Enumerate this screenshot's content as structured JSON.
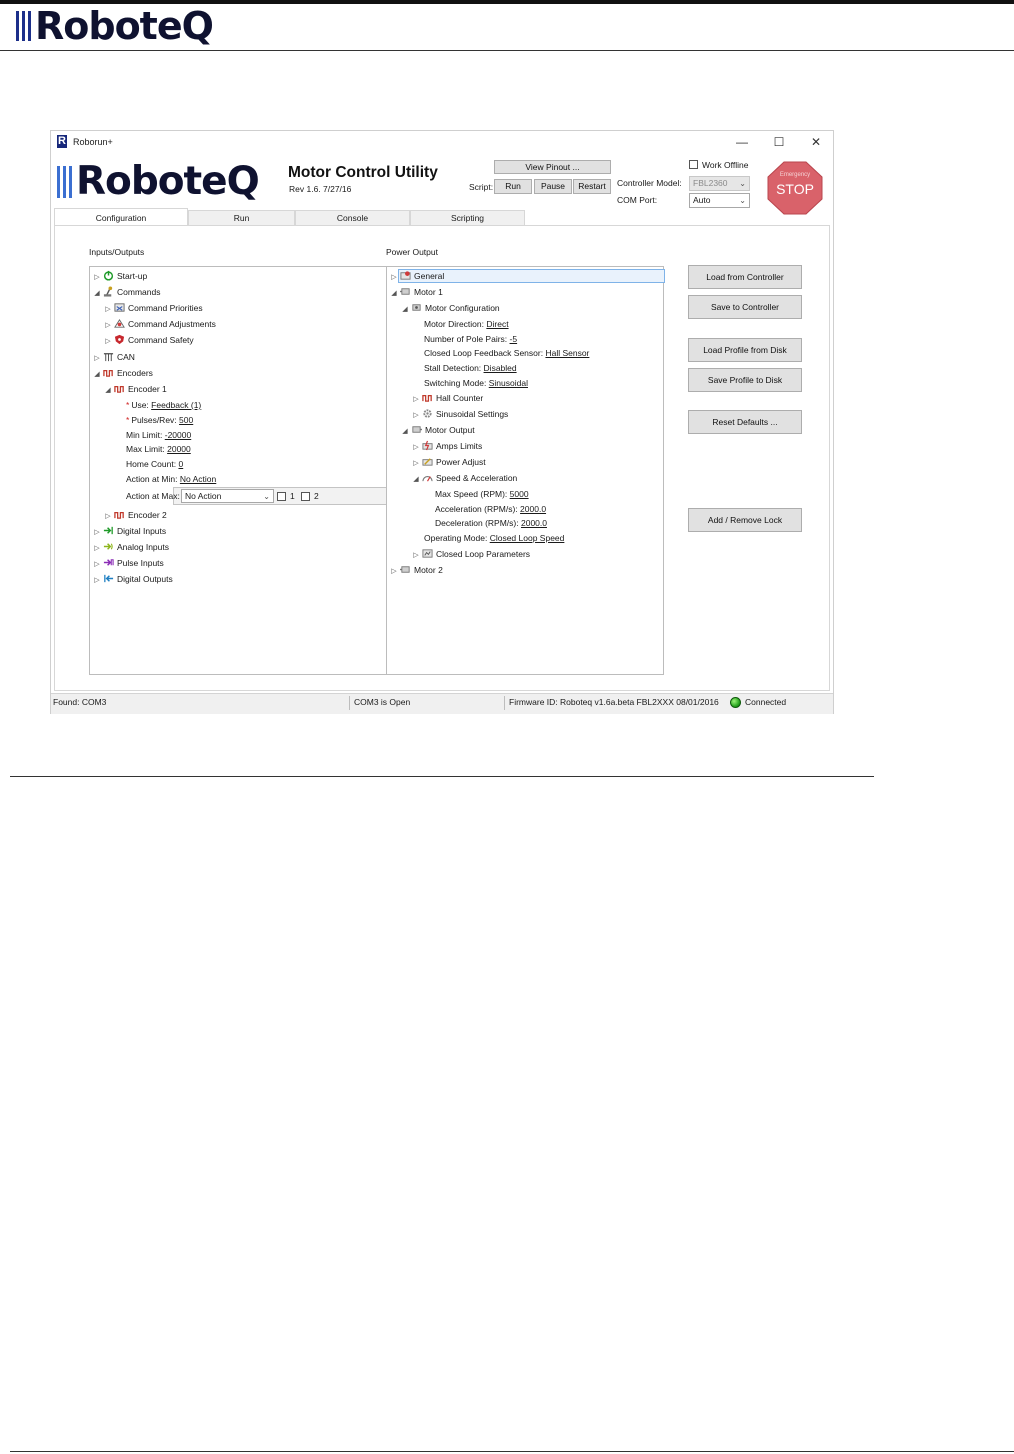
{
  "page": {
    "brand": "RoboteQ"
  },
  "window": {
    "title": "Roborun+",
    "controls": {
      "minimize": "—",
      "maximize": "☐",
      "close": "✕"
    }
  },
  "app_header": {
    "logo_text": "RoboteQ",
    "title": "Motor Control Utility",
    "revision": "Rev 1.6. 7/27/16",
    "view_pinout": "View Pinout ...",
    "script_label": "Script:",
    "run": "Run",
    "pause": "Pause",
    "restart": "Restart",
    "work_offline": "Work Offline",
    "controller_model_label": "Controller Model:",
    "controller_model_value": "FBL2360",
    "com_port_label": "COM Port:",
    "com_port_value": "Auto",
    "estop_small": "Emergency",
    "estop_big": "STOP"
  },
  "tabs": [
    "Configuration",
    "Run",
    "Console",
    "Scripting"
  ],
  "inputs_outputs": {
    "label": "Inputs/Outputs",
    "startup": "Start-up",
    "commands": "Commands",
    "command_priorities": "Command Priorities",
    "command_adjustments": "Command Adjustments",
    "command_safety": "Command Safety",
    "can": "CAN",
    "encoders": "Encoders",
    "encoder1": "Encoder 1",
    "use_label": "Use:",
    "use_value": "Feedback (1)",
    "pulses_label": "Pulses/Rev:",
    "pulses_value": "500",
    "min_limit_label": "Min Limit:",
    "min_limit_value": "-20000",
    "max_limit_label": "Max Limit:",
    "max_limit_value": "20000",
    "home_count_label": "Home Count:",
    "home_count_value": "0",
    "action_min_label": "Action at Min:",
    "action_min_value": "No Action",
    "action_max_label": "Action at Max:",
    "action_max_value": "No Action",
    "check1": "1",
    "check2": "2",
    "encoder2": "Encoder 2",
    "digital_inputs": "Digital Inputs",
    "analog_inputs": "Analog Inputs",
    "pulse_inputs": "Pulse Inputs",
    "digital_outputs": "Digital Outputs"
  },
  "power_output": {
    "label": "Power Output",
    "general": "General",
    "motor1": "Motor 1",
    "motor_config": "Motor Configuration",
    "motor_direction_label": "Motor Direction:",
    "motor_direction_value": "Direct",
    "pole_pairs_label": "Number of Pole Pairs:",
    "pole_pairs_value": "-5",
    "feedback_sensor_label": "Closed Loop Feedback Sensor:",
    "feedback_sensor_value": "Hall Sensor",
    "stall_label": "Stall Detection:",
    "stall_value": "Disabled",
    "switching_label": "Switching Mode:",
    "switching_value": "Sinusoidal",
    "hall_counter": "Hall Counter",
    "sinusoidal_settings": "Sinusoidal Settings",
    "motor_output": "Motor Output",
    "amps_limits": "Amps Limits",
    "power_adjust": "Power Adjust",
    "speed_accel": "Speed & Acceleration",
    "max_speed_label": "Max Speed (RPM):",
    "max_speed_value": "5000",
    "accel_label": "Acceleration (RPM/s):",
    "accel_value": "2000.0",
    "decel_label": "Deceleration (RPM/s):",
    "decel_value": "2000.0",
    "op_mode_label": "Operating Mode:",
    "op_mode_value": "Closed Loop Speed",
    "closed_loop_params": "Closed Loop Parameters",
    "motor2": "Motor 2"
  },
  "actions": {
    "load_controller": "Load from Controller",
    "save_controller": "Save to Controller",
    "load_profile": "Load Profile from Disk",
    "save_profile": "Save Profile to Disk",
    "reset_defaults": "Reset Defaults ...",
    "add_remove_lock": "Add / Remove Lock"
  },
  "status": {
    "found": "Found: COM3",
    "port_state": "COM3 is Open",
    "firmware": "Firmware ID: Roboteq v1.6a.beta FBL2XXX 08/01/2016",
    "connection": "Connected"
  },
  "colors": {
    "estop": "#d9626a",
    "brand_bar": "#3b6fd1",
    "led": "#23a11b"
  }
}
